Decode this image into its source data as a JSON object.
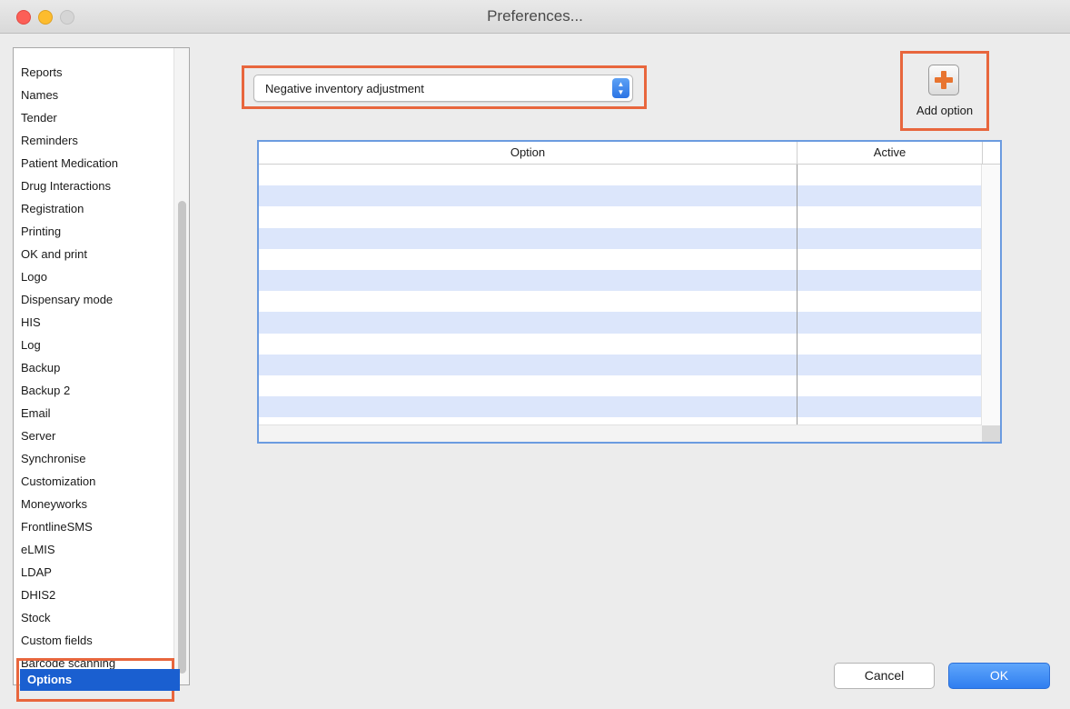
{
  "window": {
    "title": "Preferences..."
  },
  "sidebar": {
    "items": [
      {
        "label": "Reports"
      },
      {
        "label": "Names"
      },
      {
        "label": "Tender"
      },
      {
        "label": "Reminders"
      },
      {
        "label": "Patient Medication"
      },
      {
        "label": "Drug Interactions"
      },
      {
        "label": "Registration"
      },
      {
        "label": "Printing"
      },
      {
        "label": "OK and print"
      },
      {
        "label": "Logo"
      },
      {
        "label": "Dispensary mode"
      },
      {
        "label": "HIS"
      },
      {
        "label": "Log"
      },
      {
        "label": "Backup"
      },
      {
        "label": "Backup 2"
      },
      {
        "label": "Email"
      },
      {
        "label": "Server"
      },
      {
        "label": "Synchronise"
      },
      {
        "label": "Customization"
      },
      {
        "label": "Moneyworks"
      },
      {
        "label": "FrontlineSMS"
      },
      {
        "label": "eLMIS"
      },
      {
        "label": "LDAP"
      },
      {
        "label": "DHIS2"
      },
      {
        "label": "Stock"
      },
      {
        "label": "Custom fields"
      },
      {
        "label": "Barcode scanning"
      }
    ],
    "selected": "Options"
  },
  "option_type": {
    "selected": "Negative inventory adjustment"
  },
  "toolbar": {
    "add_option_label": "Add option"
  },
  "table": {
    "columns": [
      "Option",
      "Active"
    ],
    "rows": []
  },
  "footer": {
    "cancel_label": "Cancel",
    "ok_label": "OK"
  },
  "colors": {
    "highlight": "#e8663d",
    "selection": "#1a5fd0",
    "row_stripe": "#dce6fb",
    "primary_button": "#2f7ef0"
  }
}
